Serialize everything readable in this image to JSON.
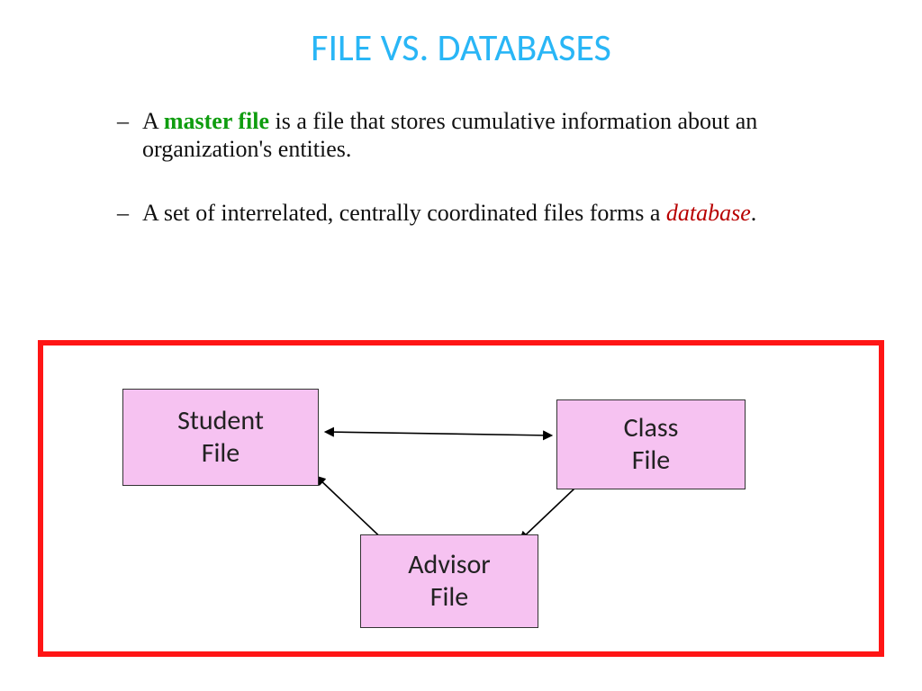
{
  "title": "FILE VS. DATABASES",
  "bullets": {
    "b1_prefix": "A ",
    "b1_term": "master file",
    "b1_rest": " is a file that stores cumulative information about an organization's entities.",
    "b2_prefix": "A set of interrelated, centrally coordinated files forms a ",
    "b2_term": "database",
    "b2_rest": "."
  },
  "boxes": {
    "student_l1": "Student",
    "student_l2": "File",
    "class_l1": "Class",
    "class_l2": "File",
    "advisor_l1": "Advisor",
    "advisor_l2": "File"
  }
}
